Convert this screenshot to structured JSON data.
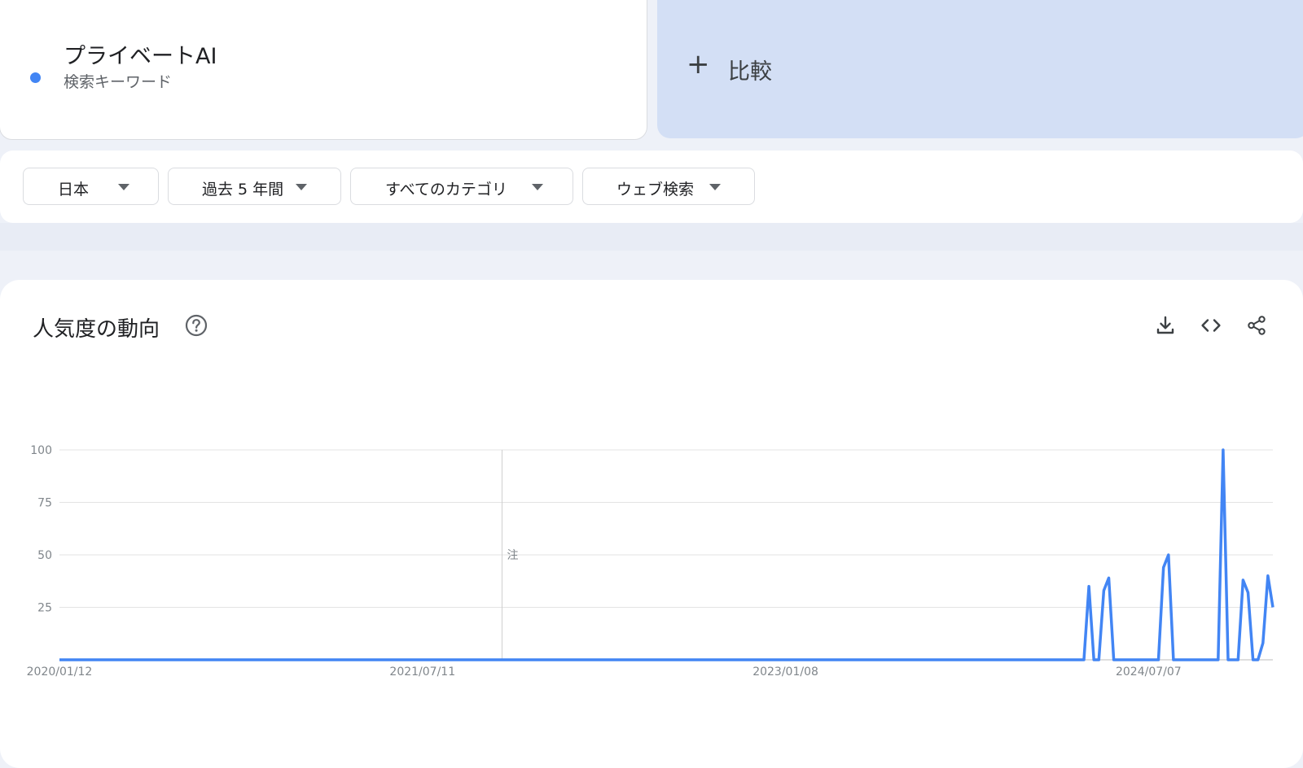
{
  "term": {
    "name": "プライベートAI",
    "type": "検索キーワード",
    "color": "#4285f4"
  },
  "compare": {
    "plus": "+",
    "label": "比較"
  },
  "filters": [
    {
      "label": "日本"
    },
    {
      "label": "過去 5 年間"
    },
    {
      "label": "すべてのカテゴリ"
    },
    {
      "label": "ウェブ検索"
    }
  ],
  "section": {
    "title": "人気度の動向",
    "icons": [
      "help-icon",
      "download-icon",
      "embed-code-icon",
      "share-icon"
    ]
  },
  "chart_data": {
    "type": "line",
    "title": "",
    "xlabel": "",
    "ylabel": "",
    "ylim": [
      0,
      100
    ],
    "yticks": [
      "100",
      "75",
      "50",
      "25"
    ],
    "xticks": [
      "2020/01/12",
      "2021/07/11",
      "2023/01/08",
      "2024/07/07"
    ],
    "note_marker": "注",
    "note_index": 89,
    "grid": true,
    "series": [
      {
        "color": "#4285f4",
        "values": [
          0,
          0,
          0,
          0,
          0,
          0,
          0,
          0,
          0,
          0,
          0,
          0,
          0,
          0,
          0,
          0,
          0,
          0,
          0,
          0,
          0,
          0,
          0,
          0,
          0,
          0,
          0,
          0,
          0,
          0,
          0,
          0,
          0,
          0,
          0,
          0,
          0,
          0,
          0,
          0,
          0,
          0,
          0,
          0,
          0,
          0,
          0,
          0,
          0,
          0,
          0,
          0,
          0,
          0,
          0,
          0,
          0,
          0,
          0,
          0,
          0,
          0,
          0,
          0,
          0,
          0,
          0,
          0,
          0,
          0,
          0,
          0,
          0,
          0,
          0,
          0,
          0,
          0,
          0,
          0,
          0,
          0,
          0,
          0,
          0,
          0,
          0,
          0,
          0,
          0,
          0,
          0,
          0,
          0,
          0,
          0,
          0,
          0,
          0,
          0,
          0,
          0,
          0,
          0,
          0,
          0,
          0,
          0,
          0,
          0,
          0,
          0,
          0,
          0,
          0,
          0,
          0,
          0,
          0,
          0,
          0,
          0,
          0,
          0,
          0,
          0,
          0,
          0,
          0,
          0,
          0,
          0,
          0,
          0,
          0,
          0,
          0,
          0,
          0,
          0,
          0,
          0,
          0,
          0,
          0,
          0,
          0,
          0,
          0,
          0,
          0,
          0,
          0,
          0,
          0,
          0,
          0,
          0,
          0,
          0,
          0,
          0,
          0,
          0,
          0,
          0,
          0,
          0,
          0,
          0,
          0,
          0,
          0,
          0,
          0,
          0,
          0,
          0,
          0,
          0,
          0,
          0,
          0,
          0,
          0,
          0,
          0,
          0,
          0,
          0,
          0,
          0,
          0,
          0,
          0,
          0,
          0,
          0,
          0,
          0,
          0,
          0,
          0,
          0,
          0,
          0,
          0,
          35,
          0,
          0,
          33,
          39,
          0,
          0,
          0,
          0,
          0,
          0,
          0,
          0,
          0,
          0,
          44,
          50,
          0,
          0,
          0,
          0,
          0,
          0,
          0,
          0,
          0,
          0,
          100,
          0,
          0,
          0,
          38,
          32,
          0,
          0,
          8,
          40,
          25
        ]
      }
    ]
  }
}
